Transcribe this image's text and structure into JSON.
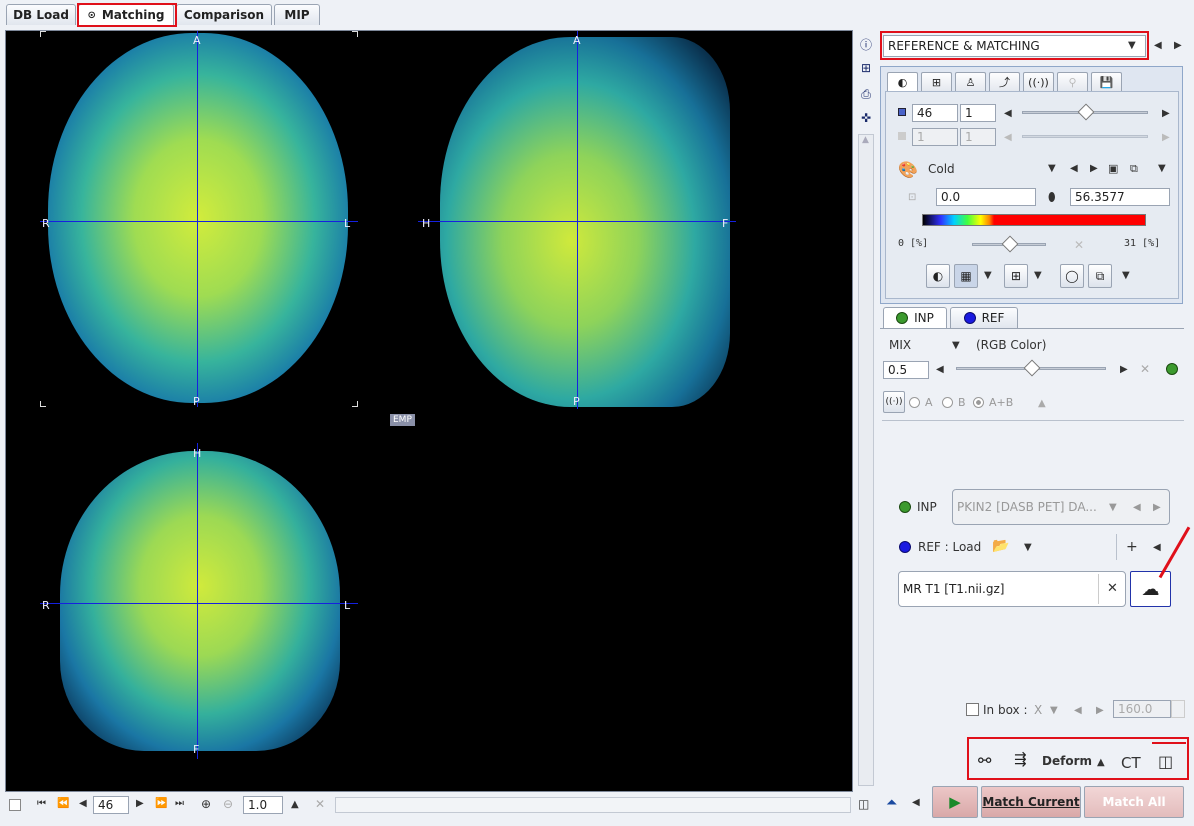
{
  "tabs": [
    {
      "label": "DB Load"
    },
    {
      "label": "Matching"
    },
    {
      "label": "Comparison"
    },
    {
      "label": "MIP"
    }
  ],
  "viewer": {
    "axial": {
      "top": "A",
      "bottom": "P",
      "left": "R",
      "right": "L"
    },
    "sagittal": {
      "top": "A",
      "bottom": "P",
      "left": "H",
      "right": "F"
    },
    "coronal": {
      "top": "H",
      "bottom": "F",
      "left": "R",
      "right": "L"
    },
    "emp_label": "EMP"
  },
  "bottom_bar": {
    "slice_value": "46",
    "zoom_value": "1.0"
  },
  "workflow": {
    "selected": "REFERENCE & MATCHING"
  },
  "color_panel": {
    "slice_value": "46",
    "step_value": "1",
    "disabled_value_1": "1",
    "disabled_value_2": "1",
    "colormap_name": "Cold",
    "min_value": "0.0",
    "max_value": "56.3577",
    "range_low": "0  [%]",
    "range_high": "31  [%]"
  },
  "series_tabs": [
    {
      "label": "INP"
    },
    {
      "label": "REF"
    }
  ],
  "fusion": {
    "mode": "MIX",
    "mode_desc": "(RGB Color)",
    "ratio": "0.5",
    "radio_a": "A",
    "radio_b": "B",
    "radio_ab": "A+B"
  },
  "inputs": {
    "inp_label": "INP",
    "inp_series": "PKIN2 [DASB PET] DA...",
    "ref_label": "REF : Load",
    "ref_series": "MR T1 [T1.nii.gz]"
  },
  "inbox": {
    "label": "In box :",
    "axis": "X",
    "value": "160.0"
  },
  "deform": {
    "label": "Deform",
    "ct_label": "CT"
  },
  "actions": {
    "match_current": "Match Current",
    "match_all": "Match All"
  },
  "colors": {
    "accent_red": "#e0101a",
    "crosshair": "#1620e0",
    "inp_dot": "#3c9a2e",
    "ref_dot": "#1a1ae0"
  }
}
